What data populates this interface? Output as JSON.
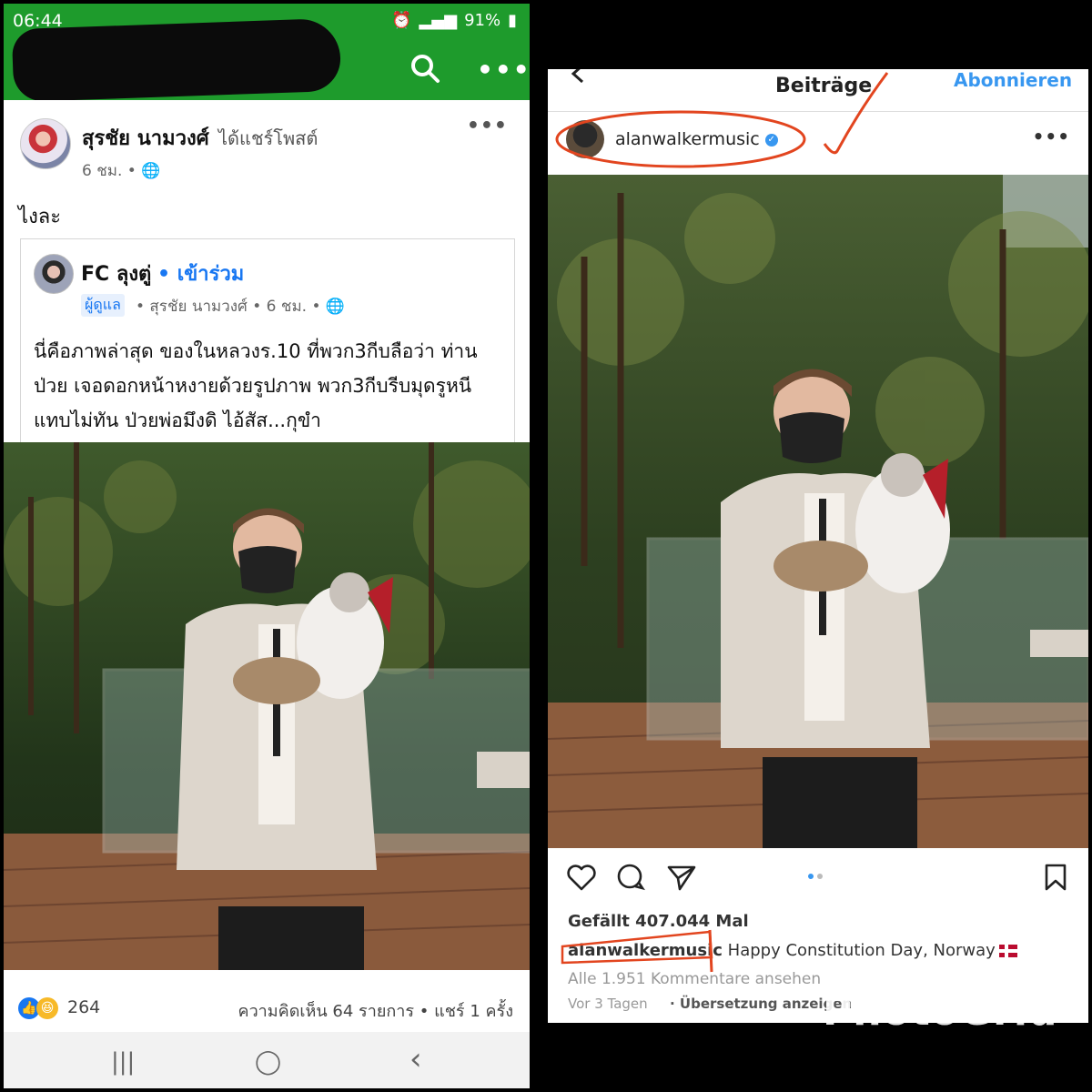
{
  "facebook": {
    "status_bar": {
      "time": "06:44",
      "battery": "91%"
    },
    "post": {
      "poster_name": "สุรชัย นามวงศ์",
      "action": "ได้แชร์โพสต์",
      "meta": "6 ชม. • 🌐",
      "text": "ไงละ"
    },
    "shared": {
      "group_name": "FC ลุงตู่",
      "join_label": "• เข้าร่วม",
      "admin_badge": "ผู้ดูแล",
      "meta": "• สุรชัย นามวงศ์ • 6 ชม. • 🌐",
      "text": "นี่คือภาพล่าสุด ของในหลวงร.10 ที่พวก3กีบลือว่า ท่านป่วย เจอดอกหน้าหงายด้วยรูปภาพ พวก3กีบรีบมุดรูหนีแทบไม่ทัน ป่วยพ่อมึงดิ ไอ้สัส...กุขำ"
    },
    "reactions": {
      "count": "264",
      "comments_shares": "ความคิดเห็น 64 รายการ • แชร์ 1 ครั้ง"
    },
    "nav": {
      "recents": "|||",
      "home": "◯",
      "back": "‹"
    }
  },
  "instagram": {
    "header_title": "Beiträge",
    "subscribe_label": "Abonnieren",
    "username": "alanwalkermusic",
    "likes": "Gefällt 407.044 Mal",
    "caption_user": "alanwalkermusic",
    "caption_text": "Happy Constitution Day, Norway",
    "view_comments": "Alle 1.951 Kommentare ansehen",
    "time": "Vor 3 Tagen",
    "translate": "· Übersetzung anzeigen"
  },
  "watermark": "PhotoGrid",
  "colors": {
    "fb_green": "#1e9b2c",
    "fb_blue": "#1877f2",
    "ig_blue": "#3897f0",
    "annotation_red": "#e2451f"
  }
}
